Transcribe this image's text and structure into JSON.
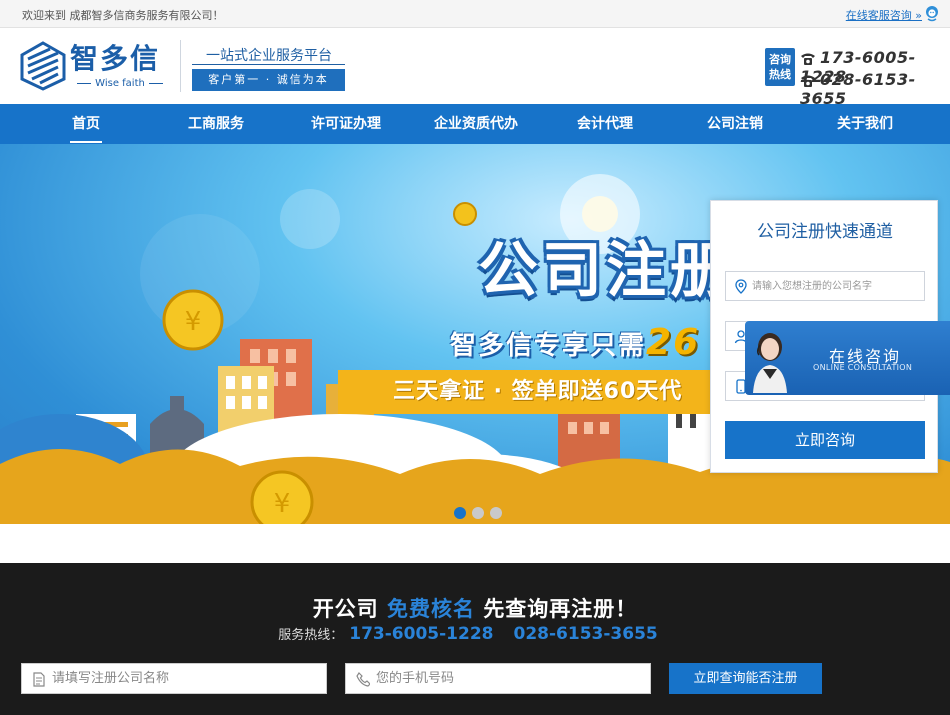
{
  "topbar": {
    "welcome": "欢迎来到 成都智多信商务服务有限公司！",
    "online_service": "在线客服咨询 »"
  },
  "header": {
    "logo_cn": "智多信",
    "logo_en": "Wise faith",
    "slogan_main": "一站式企业服务平台",
    "slogan_sub": "客户第一 · 诚信为本",
    "hotline_label_1": "咨询",
    "hotline_label_2": "热线",
    "phone_1": "173-6005-1228",
    "phone_2": "028-6153-3655"
  },
  "nav": {
    "items": [
      {
        "label": "首页"
      },
      {
        "label": "工商服务"
      },
      {
        "label": "许可证办理"
      },
      {
        "label": "企业资质代办"
      },
      {
        "label": "会计代理"
      },
      {
        "label": "公司注销"
      },
      {
        "label": "关于我们"
      }
    ]
  },
  "banner": {
    "headline": "公司注册",
    "subline": "智多信专享只需",
    "price": "26",
    "ribbon": "三天拿证 · 签单即送60天代",
    "slides": 3
  },
  "panel": {
    "title": "公司注册快速通道",
    "company_placeholder": "请输入您想注册的公司名字",
    "name_placeholder": "",
    "phone_placeholder": "",
    "submit": "立即咨询"
  },
  "consult": {
    "cn": "在线咨询",
    "en": "ONLINE CONSULTATION"
  },
  "query": {
    "title_a": "开公司",
    "title_b": "免费核名",
    "title_c": "先查询再注册！",
    "tel_label": "服务热线：",
    "tel_1": "173-6005-1228",
    "tel_2": "028-6153-3655",
    "company_placeholder": "请填写注册公司名称",
    "phone_placeholder": "您的手机号码",
    "submit": "立即查询能否注册"
  },
  "colors": {
    "brand_blue": "#1773c9",
    "accent_gold": "#f3b41a",
    "dark_band": "#1b1b1b"
  }
}
